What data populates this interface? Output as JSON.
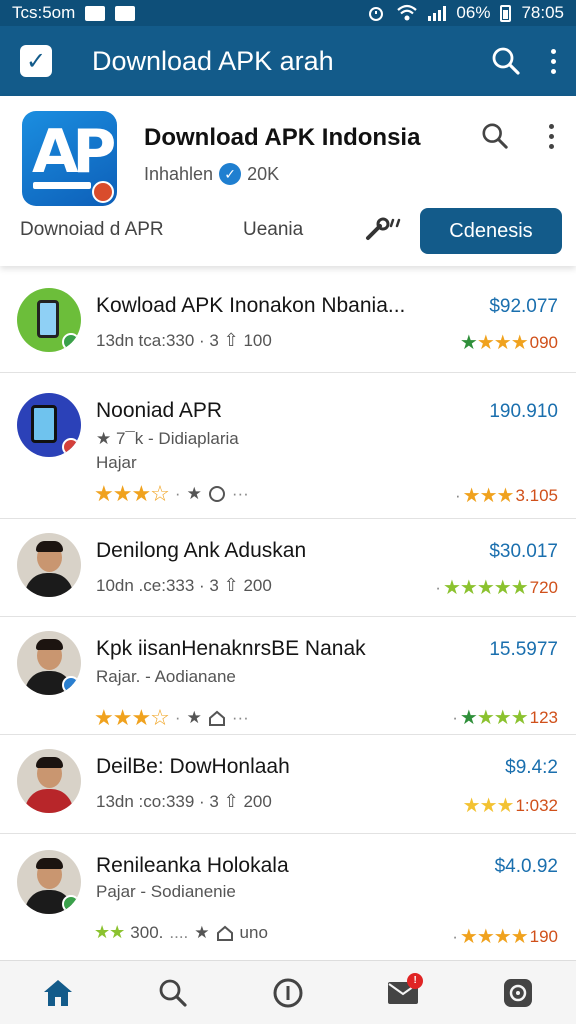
{
  "status_bar": {
    "time_left": "Tcs:5om",
    "battery": "06%",
    "time_right": "78:05"
  },
  "app_bar": {
    "title": "Download APK arah",
    "icons": [
      "check-icon",
      "search-icon",
      "more-vert-icon"
    ]
  },
  "app_header": {
    "name": "Download APK Indonsia",
    "publisher": "Inhahlen",
    "count": "20K",
    "tabs": [
      {
        "label": "Downoiad d APR"
      },
      {
        "label": "Ueania"
      },
      {
        "label": "Cdenesis",
        "active": true
      }
    ],
    "tab_icon": "wrench-icon"
  },
  "items": [
    {
      "title": "Kowload APK Inonakon Nbania...",
      "sub": "13dn tca:330 · 3",
      "downloads": "100",
      "price": "$92.077",
      "rating_value": "090",
      "rating_stars": 3.5
    },
    {
      "title": "Nooniad APR",
      "sub": "★ 7¯k - Didiaplaria",
      "sub2": "Hajar",
      "price": "190.910",
      "left_stars": 3,
      "rating_value": "3.105",
      "rating_stars": 3
    },
    {
      "title": "Denilong Ank Aduskan",
      "sub": "10dn .ce:333 · 3",
      "downloads": "200",
      "price": "$30.017",
      "rating_value": "720",
      "rating_stars": 5
    },
    {
      "title": "Kpk iisanHenaknrsBE Nanak",
      "sub": "Rajar. - Aodianane",
      "price": "15.5977",
      "left_stars": 3,
      "rating_value": "123",
      "rating_stars": 4
    },
    {
      "title": "DeilBe: DowHonlaah",
      "sub": "13dn :co:339 · 3",
      "downloads": "200",
      "price": "$9.4:2",
      "rating_value": "1:032",
      "rating_stars": 3
    },
    {
      "title": "Renileanka Holokala",
      "sub": "Pajar - Sodianenie",
      "price": "$4.0.92",
      "left_text": "300.",
      "left_extra": "uno",
      "rating_value": "190",
      "rating_stars": 3.5
    }
  ],
  "bottom_nav": {
    "items": [
      "home-icon",
      "search-icon",
      "info-icon",
      "mail-icon",
      "settings-icon"
    ],
    "mail_badge": "!"
  },
  "colors": {
    "primary": "#135b8a",
    "price": "#1a6fae",
    "star": "#f0a21e",
    "star_green": "#8bc22f"
  }
}
